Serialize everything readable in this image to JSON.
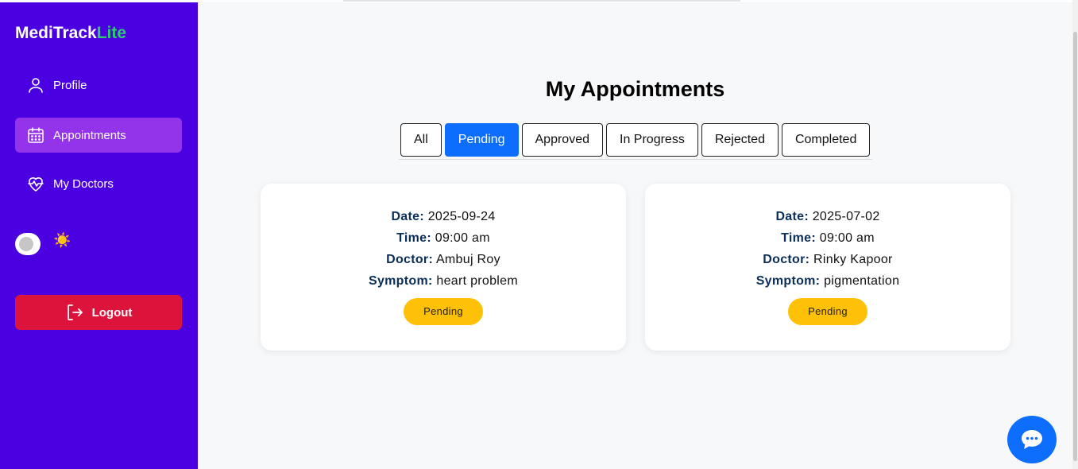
{
  "brand": {
    "name": "MediTrack",
    "suffix": "Lite"
  },
  "sidebar": {
    "items": [
      {
        "label": "Profile",
        "icon": "user-icon"
      },
      {
        "label": "Appointments",
        "icon": "calendar-icon",
        "active": true
      },
      {
        "label": "My Doctors",
        "icon": "heart-pulse-icon"
      }
    ],
    "theme_icon": "☀️",
    "logout_label": "Logout"
  },
  "page": {
    "title": "My Appointments"
  },
  "tabs": [
    {
      "label": "All"
    },
    {
      "label": "Pending",
      "active": true
    },
    {
      "label": "Approved"
    },
    {
      "label": "In Progress"
    },
    {
      "label": "Rejected"
    },
    {
      "label": "Completed"
    }
  ],
  "labels": {
    "date": "Date:",
    "time": "Time:",
    "doctor": "Doctor:",
    "symptom": "Symptom:"
  },
  "appointments": [
    {
      "date": "2025-09-24",
      "time": "09:00 am",
      "doctor": "Ambuj Roy",
      "symptom": "heart problem",
      "status": "Pending"
    },
    {
      "date": "2025-07-02",
      "time": "09:00 am",
      "doctor": "Rinky Kapoor",
      "symptom": "pigmentation",
      "status": "Pending"
    }
  ],
  "colors": {
    "sidebar_bg": "#4a00e0",
    "active_item": "#9333ea",
    "brand_accent": "#2ecc71",
    "logout": "#dc143c",
    "active_tab": "#0d6efd",
    "pending_badge": "#ffc107",
    "label_text": "#0b2e59"
  }
}
